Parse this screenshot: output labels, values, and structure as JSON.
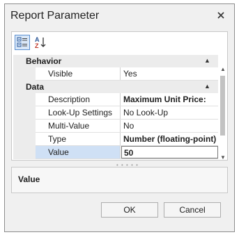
{
  "dialog": {
    "title": "Report Parameter",
    "close_icon": "close-icon"
  },
  "toolbar": {
    "categorized_icon": "categorized-view-icon",
    "alphabetical_icon": "sort-alphabetical-icon"
  },
  "categories": [
    {
      "label": "Behavior",
      "properties": [
        {
          "name": "Visible",
          "value": "Yes",
          "bold": false
        }
      ]
    },
    {
      "label": "Data",
      "properties": [
        {
          "name": "Description",
          "value": "Maximum Unit Price:",
          "bold": true
        },
        {
          "name": "Look-Up Settings",
          "value": "No Look-Up",
          "bold": false
        },
        {
          "name": "Multi-Value",
          "value": "No",
          "bold": false
        },
        {
          "name": "Type",
          "value": "Number (floating-point)",
          "bold": true
        },
        {
          "name": "Value",
          "value": "50",
          "bold": true,
          "selected": true
        }
      ]
    }
  ],
  "description": {
    "title": "Value"
  },
  "buttons": {
    "ok": "OK",
    "cancel": "Cancel"
  },
  "colors": {
    "selection": "#cfe0f5",
    "category_bg": "#ececec",
    "accent_border": "#5b8fd0"
  }
}
